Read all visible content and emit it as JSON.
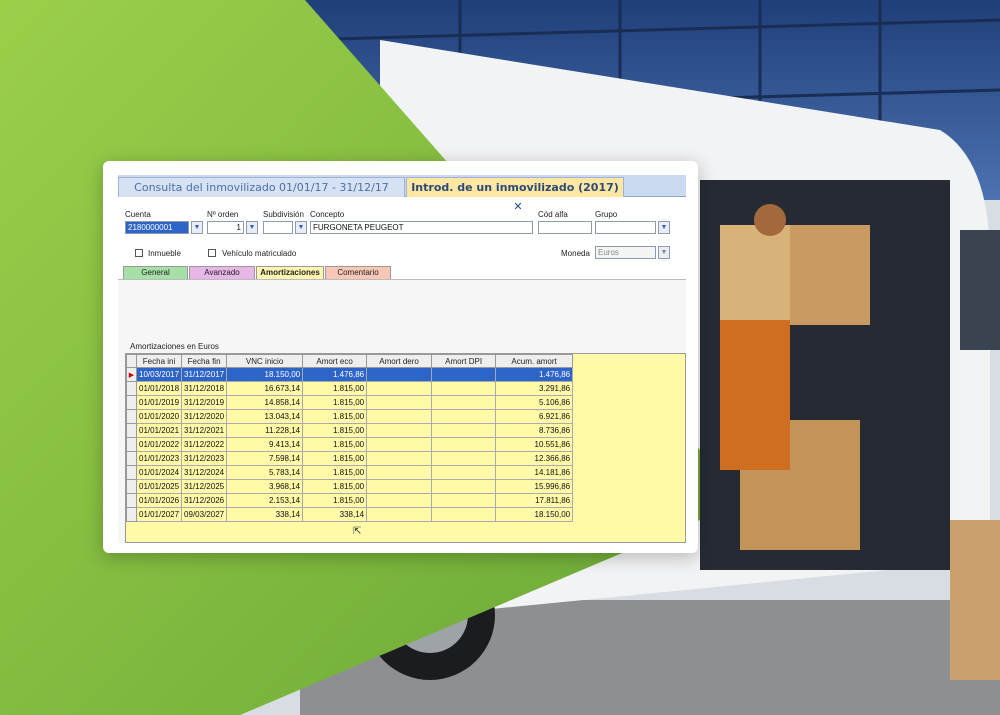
{
  "window": {
    "tabs": [
      {
        "label": "Consulta del inmovilizado   01/01/17 - 31/12/17",
        "active": false
      },
      {
        "label": "Introd. de un inmovilizado  (2017)",
        "active": true
      }
    ],
    "close_icon": "✕"
  },
  "form": {
    "cuenta_label": "Cuenta",
    "cuenta_value": "2180000001",
    "orden_label": "Nº orden",
    "orden_value": "1",
    "subdivision_label": "Subdivisión",
    "subdivision_value": "",
    "concepto_label": "Concepto",
    "concepto_value": "FURGONETA PEUGEOT",
    "cod_alfa_label": "Cód alfa",
    "cod_alfa_value": "",
    "grupo_label": "Grupo",
    "grupo_value": "",
    "inmueble_label": "Inmueble",
    "vehiculo_label": "Vehículo matriculado",
    "moneda_label": "Moneda",
    "moneda_value": "Euros"
  },
  "subtabs": [
    "General",
    "Avanzado",
    "Amortizaciones",
    "Comentario"
  ],
  "section_label": "Amortizaciones en Euros",
  "grid": {
    "headers": [
      "Fecha ini",
      "Fecha fin",
      "VNC inicio",
      "Amort eco",
      "Amort dero",
      "Amort DPI",
      "Acum. amort"
    ],
    "rows": [
      [
        "10/03/2017",
        "31/12/2017",
        "18.150,00",
        "1.476,86",
        "",
        "",
        "1.476,86"
      ],
      [
        "01/01/2018",
        "31/12/2018",
        "16.673,14",
        "1.815,00",
        "",
        "",
        "3.291,86"
      ],
      [
        "01/01/2019",
        "31/12/2019",
        "14.858,14",
        "1.815,00",
        "",
        "",
        "5.106,86"
      ],
      [
        "01/01/2020",
        "31/12/2020",
        "13.043,14",
        "1.815,00",
        "",
        "",
        "6.921,86"
      ],
      [
        "01/01/2021",
        "31/12/2021",
        "11.228,14",
        "1.815,00",
        "",
        "",
        "8.736,86"
      ],
      [
        "01/01/2022",
        "31/12/2022",
        "9.413,14",
        "1.815,00",
        "",
        "",
        "10.551,86"
      ],
      [
        "01/01/2023",
        "31/12/2023",
        "7.598,14",
        "1.815,00",
        "",
        "",
        "12.366,86"
      ],
      [
        "01/01/2024",
        "31/12/2024",
        "5.783,14",
        "1.815,00",
        "",
        "",
        "14.181,86"
      ],
      [
        "01/01/2025",
        "31/12/2025",
        "3.968,14",
        "1.815,00",
        "",
        "",
        "15.996,86"
      ],
      [
        "01/01/2026",
        "31/12/2026",
        "2.153,14",
        "1.815,00",
        "",
        "",
        "17.811,86"
      ],
      [
        "01/01/2027",
        "09/03/2027",
        "338,14",
        "338,14",
        "",
        "",
        "18.150,00"
      ]
    ],
    "selected_row": 0,
    "row_indicator": "▶"
  },
  "colors": {
    "accent_green": "#8cc63f",
    "selection_blue": "#2d64c8",
    "grid_yellow": "#fff9a8"
  }
}
